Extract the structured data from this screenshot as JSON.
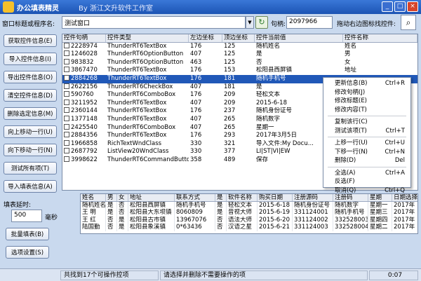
{
  "window": {
    "title": "办公填表精灵",
    "subtitle": "By 浙江文升软件工作室"
  },
  "toolbar": {
    "window_label": "窗口标题或程序名:",
    "window_value": "测试窗口",
    "handle_label": "句柄:",
    "handle_value": "2097966",
    "drag_label": "拖动右边图标找控件:"
  },
  "left_buttons": [
    "获取控件信息(E)",
    "导入控件信息(I)",
    "导出控件信息(O)",
    "清空控件信息(D)",
    "删除选定信息(M)",
    "向上移动一行(U)",
    "向下移动一行(N)",
    "测试所有项(T)",
    "导入填表信息(A)"
  ],
  "delay": {
    "label": "填表延时:",
    "value": "500",
    "unit": "毫秒"
  },
  "bottom_buttons": [
    "批量填表(B)",
    "选项设置(S)"
  ],
  "control_table": {
    "headers": [
      "控件句柄",
      "控件类型",
      "左边坐标",
      "顶边坐标",
      "控件当前值",
      "控件名称"
    ],
    "rows": [
      [
        "2228974",
        "ThunderRT6TextBox",
        "176",
        "125",
        "随机姓名",
        "姓名"
      ],
      [
        "1246028",
        "ThunderRT6OptionButton",
        "407",
        "125",
        "是",
        "男"
      ],
      [
        "983832",
        "ThunderRT6OptionButton",
        "463",
        "125",
        "否",
        "女"
      ],
      [
        "3867470",
        "ThunderRT6TextBox",
        "176",
        "153",
        "松阳县西屏镇",
        "地址"
      ],
      [
        "2884268",
        "ThunderRT6TextBox",
        "176",
        "181",
        "随机手机号",
        ""
      ],
      [
        "2622156",
        "ThunderRT6CheckBox",
        "407",
        "181",
        "是",
        ""
      ],
      [
        "590760",
        "ThunderRT6ComboBox",
        "176",
        "209",
        "轻松文本",
        ""
      ],
      [
        "3211952",
        "ThunderRT6TextBox",
        "407",
        "209",
        "2015-6-18",
        ""
      ],
      [
        "2360144",
        "ThunderRT6TextBox",
        "176",
        "237",
        "随机身份证号",
        ""
      ],
      [
        "1377148",
        "ThunderRT6TextBox",
        "407",
        "265",
        "随机数字",
        ""
      ],
      [
        "2425540",
        "ThunderRT6ComboBox",
        "407",
        "265",
        "星期一",
        ""
      ],
      [
        "2884356",
        "ThunderRT6TextBox",
        "176",
        "293",
        "2017年3月5日",
        ""
      ],
      [
        "1966858",
        "RichTextWndClass",
        "330",
        "321",
        "导入文件:My Docu...",
        ""
      ],
      [
        "2687792",
        "ListView20WndClass",
        "330",
        "377",
        "LI|ST|VI|EW",
        ""
      ],
      [
        "3998622",
        "ThunderRT6CommandButton",
        "358",
        "489",
        "保存",
        ""
      ]
    ]
  },
  "context_menu": {
    "items": [
      {
        "label": "更新信息(B)",
        "key": "Ctrl+R"
      },
      {
        "label": "修改句柄(J)",
        "key": ""
      },
      {
        "label": "修改标题(E)",
        "key": ""
      },
      {
        "label": "修改内容(T)",
        "key": ""
      },
      {
        "sep": true
      },
      {
        "label": "复制该行(C)",
        "key": ""
      },
      {
        "label": "测试该项(T)",
        "key": "Ctrl+T"
      },
      {
        "sep": true
      },
      {
        "label": "上移一行(U)",
        "key": "Ctrl+U"
      },
      {
        "label": "下移一行(N)",
        "key": "Ctrl+N"
      },
      {
        "label": "删除(D)",
        "key": "Del"
      },
      {
        "sep": true
      },
      {
        "label": "全选(A)",
        "key": "Ctrl+A"
      },
      {
        "label": "反选(F)",
        "key": ""
      },
      {
        "label": "取消(Q)",
        "key": "Ctrl+Q"
      }
    ]
  },
  "fill_table": {
    "headers": [
      "姓名",
      "男",
      "女",
      "地址",
      "联系方式",
      "是",
      "软件名称",
      "购买日期",
      "注册源码",
      "注册码",
      "星期",
      "日期选择"
    ],
    "rows": [
      [
        "随机姓名",
        "是",
        "否",
        "松阳县西屏镇",
        "随机手机号",
        "是",
        "轻松文本",
        "2015-6-18",
        "随机身份证号",
        "随机数字",
        "星期一",
        "2017年"
      ],
      [
        "王  明",
        "是",
        "否",
        "松阳县大东坝镇",
        "8060809",
        "是",
        "音视大师",
        "2015-6-19",
        "331124001",
        "随机手机号",
        "星期三",
        "2017年"
      ],
      [
        "王  红",
        "否",
        "是",
        "松阳县古市镇",
        "13967076",
        "否",
        "语法大师",
        "2015-6-20",
        "331124002",
        "332528003",
        "星期四",
        "2017年"
      ],
      [
        "陆国勤",
        "否",
        "是",
        "松阳县象溪镇",
        "0*63436",
        "否",
        "汉语之星",
        "2015-6-21",
        "331124003",
        "332528004",
        "星期二",
        "2017年"
      ]
    ]
  },
  "status": {
    "left": "共找到17个可操作控项",
    "mid": "请选择并删除不需要操作的项",
    "time": "0:07"
  }
}
